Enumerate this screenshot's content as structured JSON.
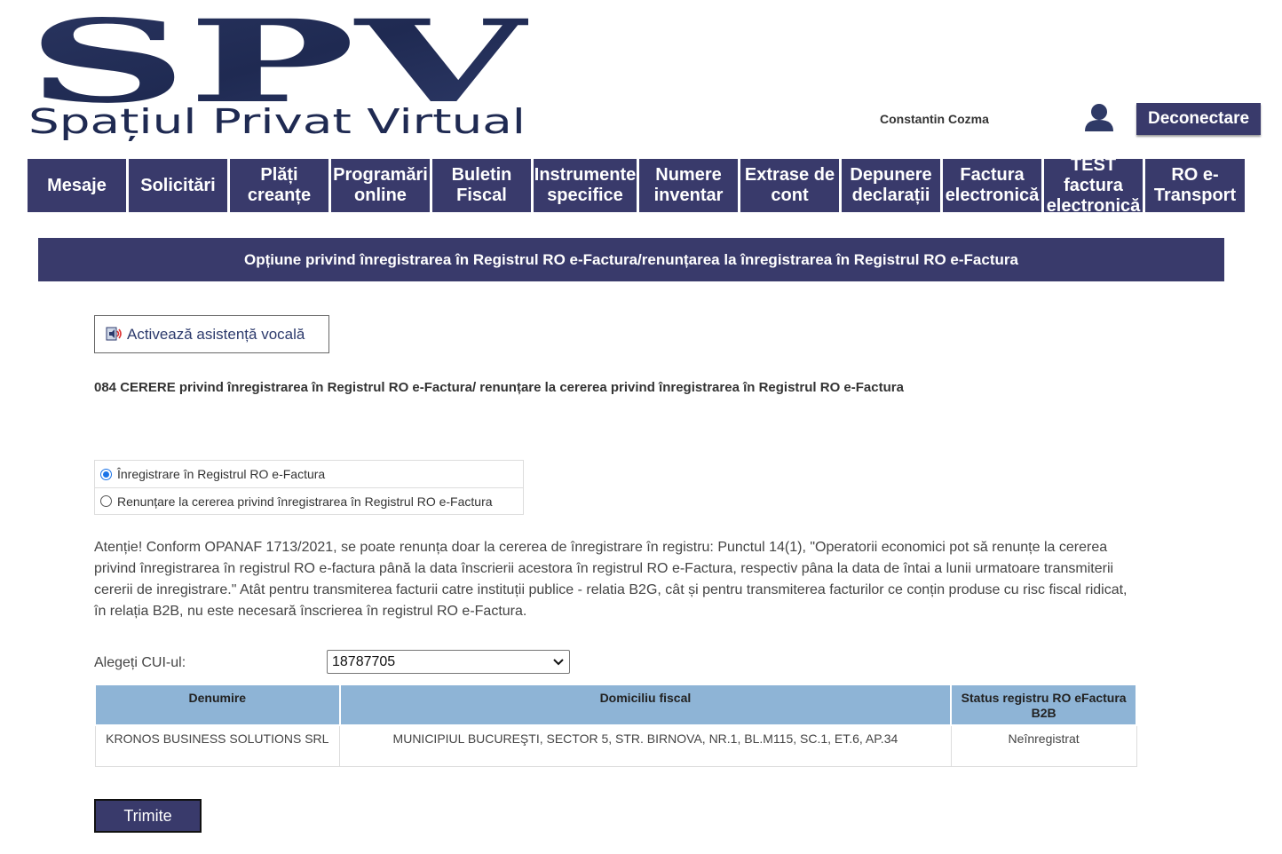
{
  "header": {
    "logo_text": "SPV",
    "logo_subtitle": "Spațiul Privat Virtual",
    "username": "Constantin Cozma",
    "logout_label": "Deconectare"
  },
  "nav": [
    {
      "label": "Mesaje"
    },
    {
      "label": "Solicitări"
    },
    {
      "label": "Plăți creanțe"
    },
    {
      "label": "Programări online"
    },
    {
      "label": "Buletin Fiscal"
    },
    {
      "label": "Instrumente specifice"
    },
    {
      "label": "Numere inventar"
    },
    {
      "label": "Extrase de cont"
    },
    {
      "label": "Depunere declarații"
    },
    {
      "label": "Factura electronică"
    },
    {
      "label": "TEST factura electronică"
    },
    {
      "label": "RO e-Transport"
    }
  ],
  "page_title": "Opțiune privind înregistrarea în Registrul RO e-Factura/renunțarea la înregistrarea în Registrul RO e-Factura",
  "voice_button": "Activează asistență vocală",
  "form_title": "084 CERERE privind înregistrarea în Registrul RO e-Factura/ renunțare la cererea privind înregistrarea în Registrul RO e-Factura",
  "options": [
    {
      "label": "Înregistrare în Registrul RO e-Factura",
      "checked": true
    },
    {
      "label": "Renunțare la cererea privind înregistrarea în Registrul RO e-Factura",
      "checked": false
    }
  ],
  "notice": "Atenție! Conform OPANAF 1713/2021, se poate renunța doar la cererea de înregistrare în registru: Punctul 14(1), \"Operatorii economici pot să renunțe la cererea privind înregistrarea în registrul RO e-factura până la data înscrierii acestora în registrul RO e-Factura, respectiv pâna la data de întai a lunii urmatoare transmiterii cererii de inregistrare.\" Atât pentru transmiterea facturii catre instituții publice - relatia B2G, cât și pentru transmiterea facturilor ce conțin produse cu risc fiscal ridicat, în relația B2B, nu este necesară înscrierea în registrul RO e-Factura.",
  "cui": {
    "label": "Alegeți CUI-ul:",
    "selected": "18787705"
  },
  "table": {
    "headers": [
      "Denumire",
      "Domiciliu fiscal",
      "Status registru RO eFactura B2B"
    ],
    "rows": [
      [
        "KRONOS BUSINESS SOLUTIONS SRL",
        "MUNICIPIUL BUCUREŞTI, SECTOR 5, STR. BIRNOVA, NR.1, BL.M115, SC.1, ET.6, AP.34",
        "Neînregistrat"
      ]
    ]
  },
  "submit_label": "Trimite",
  "colors": {
    "brand": "#393a6b",
    "table_header": "#8eb4d6"
  }
}
